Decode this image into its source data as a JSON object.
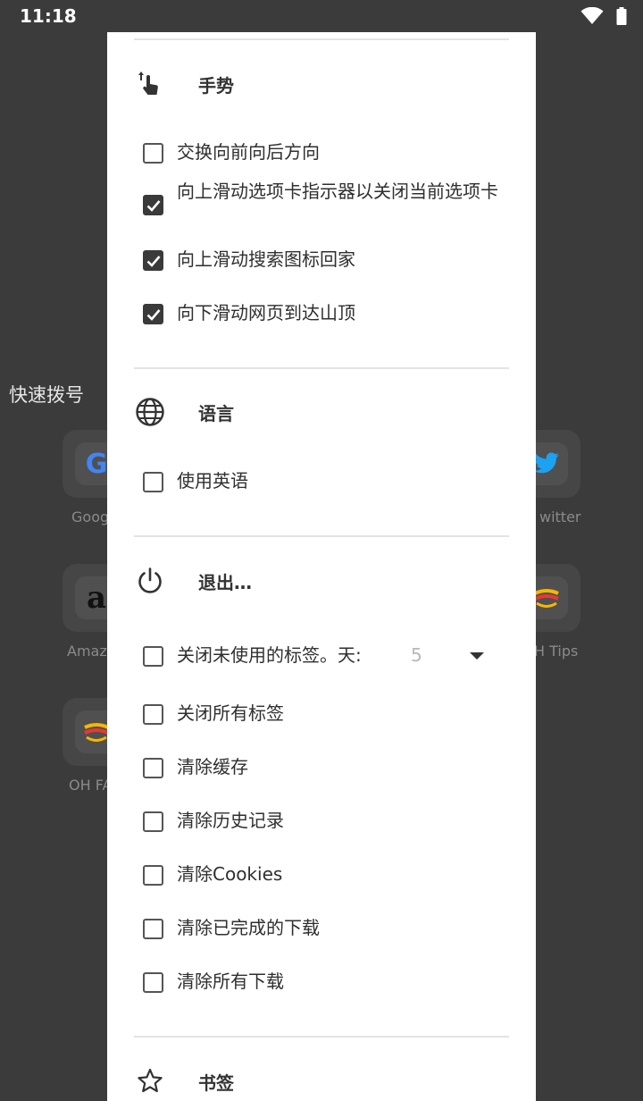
{
  "status_bar": {
    "time": "11:18"
  },
  "background": {
    "speed_dial_title": "快速拨号",
    "tiles": [
      {
        "label": "Goog",
        "icon": "google-icon"
      },
      {
        "label": "witter",
        "icon": "twitter-icon"
      },
      {
        "label": "Amaz",
        "icon": "amazon-icon"
      },
      {
        "label": "H Tips",
        "icon": "oh-icon"
      },
      {
        "label": "OH FA",
        "icon": "oh-icon"
      }
    ]
  },
  "dialog": {
    "gestures": {
      "title": "手势",
      "icon": "swipe-gesture-icon",
      "options": [
        {
          "label": "交换向前向后方向",
          "checked": false
        },
        {
          "label": "向上滑动选项卡指示器以关闭当前选项卡",
          "checked": true
        },
        {
          "label": "向上滑动搜索图标回家",
          "checked": true
        },
        {
          "label": "向下滑动网页到达山顶",
          "checked": true
        }
      ]
    },
    "language": {
      "title": "语言",
      "icon": "globe-icon",
      "options": [
        {
          "label": "使用英语",
          "checked": false
        }
      ]
    },
    "exit": {
      "title": "退出…",
      "icon": "power-icon",
      "close_unused_label": "关闭未使用的标签。天:",
      "close_unused_checked": false,
      "days_value": "5",
      "options": [
        {
          "label": "关闭所有标签",
          "checked": false
        },
        {
          "label": "清除缓存",
          "checked": false
        },
        {
          "label": "清除历史记录",
          "checked": false
        },
        {
          "label": "清除Cookies",
          "checked": false
        },
        {
          "label": "清除已完成的下载",
          "checked": false
        },
        {
          "label": "清除所有下载",
          "checked": false
        }
      ]
    },
    "bookmarks": {
      "title": "书签",
      "icon": "star-icon"
    }
  }
}
